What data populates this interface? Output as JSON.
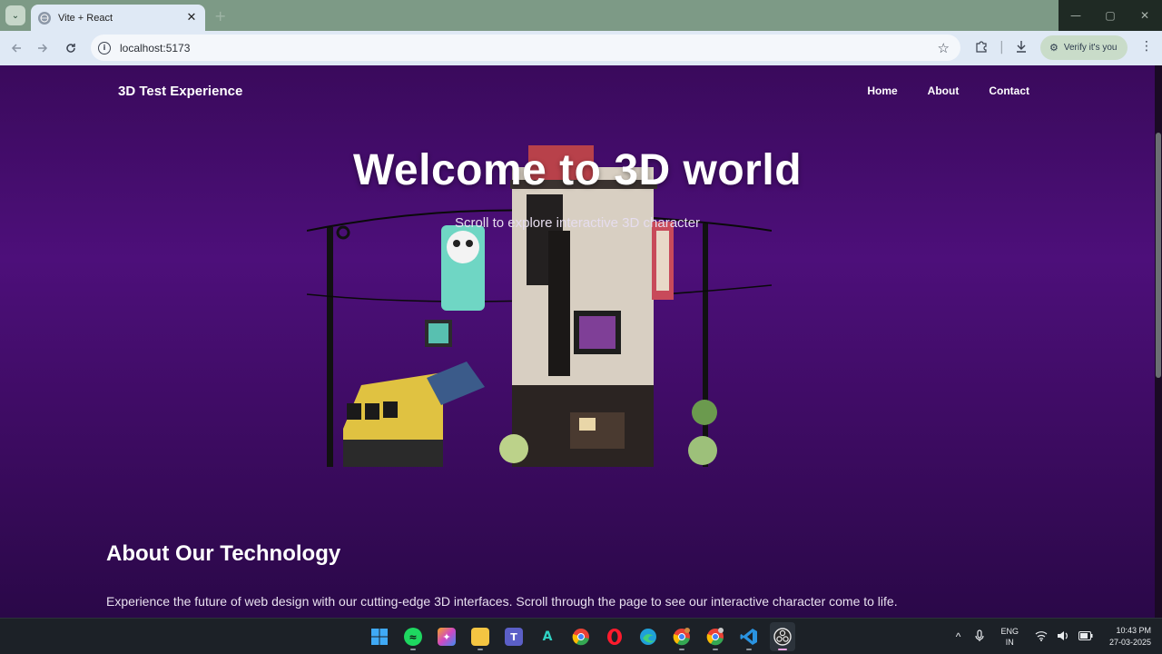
{
  "browser": {
    "tab_title": "Vite + React",
    "tab_close": "✕",
    "new_tab": "+",
    "url": "localhost:5173",
    "verify_label": "Verify it's you",
    "window_controls": [
      "—",
      "▢",
      "✕"
    ],
    "icons": {
      "back": "arrow-left-icon",
      "forward": "arrow-right-icon",
      "reload": "reload-icon",
      "site_info": "site-info-icon",
      "bookmark": "star-icon",
      "extensions": "puzzle-icon",
      "downloads": "download-icon",
      "menu": "more-vertical-icon"
    }
  },
  "site": {
    "brand": "3D Test Experience",
    "nav": [
      "Home",
      "About",
      "Contact"
    ],
    "hero_title": "Welcome to 3D world",
    "hero_subtitle": "Scroll to explore interactive 3D character",
    "about_title": "About Our Technology",
    "about_text": "Experience the future of web design with our cutting-edge 3D interfaces. Scroll through the page to see our interactive character come to life."
  },
  "taskbar": {
    "apps": [
      "windows-start-icon",
      "spotify-icon",
      "copilot-icon",
      "file-explorer-icon",
      "teams-icon",
      "autodesk-icon",
      "chrome-icon",
      "opera-icon",
      "edge-icon",
      "chrome-profile-icon",
      "chrome-profile-2-icon",
      "vscode-icon",
      "obs-icon"
    ],
    "lang_top": "ENG",
    "lang_bottom": "IN",
    "time": "10:43 PM",
    "date": "27-03-2025"
  },
  "colors": {
    "page_gradient_top": "#3a0a5c",
    "page_gradient_mid": "#4d0f7a",
    "chrome_bg": "#dfe9f5",
    "tabstrip_bg": "#7d9a86"
  }
}
